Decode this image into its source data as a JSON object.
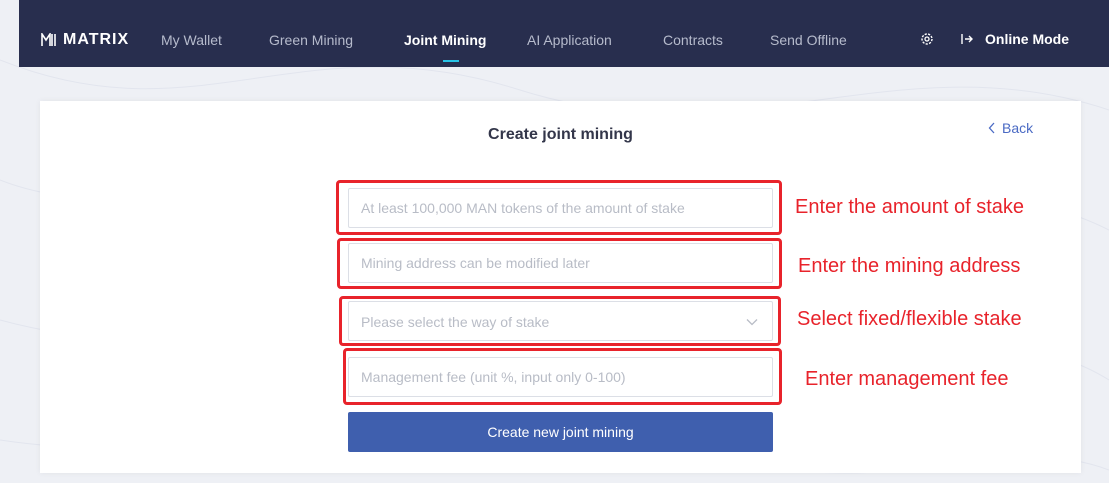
{
  "app": {
    "logo_text": "MATRIX"
  },
  "nav": {
    "items": [
      {
        "label": "My Wallet"
      },
      {
        "label": "Green Mining"
      },
      {
        "label": "Joint Mining",
        "active": true
      },
      {
        "label": "AI Application"
      },
      {
        "label": "Contracts"
      },
      {
        "label": "Send Offline"
      }
    ],
    "settings_icon": "gear-icon",
    "online_mode_icon": "login-icon",
    "online_mode_label": "Online Mode"
  },
  "page": {
    "title": "Create joint mining",
    "back_label": "Back",
    "back_icon": "chevron-left-icon"
  },
  "form": {
    "stake_amount": {
      "value": "",
      "placeholder": "At least 100,000 MAN tokens of the amount of stake"
    },
    "mining_address": {
      "value": "",
      "placeholder": "Mining address can be modified later"
    },
    "stake_way": {
      "placeholder": "Please select the way of stake",
      "icon": "chevron-down-icon"
    },
    "management_fee": {
      "value": "",
      "placeholder": "Management fee (unit %, input only 0-100)"
    },
    "submit_label": "Create new joint mining"
  },
  "annotations": {
    "stake_amount": "Enter the amount of stake",
    "mining_address": "Enter the mining address",
    "stake_way": "Select fixed/flexible stake",
    "management_fee": "Enter management fee"
  },
  "colors": {
    "topbar": "#282e4e",
    "accent_underline": "#28c3e6",
    "primary_button": "#3f5fae",
    "link": "#4a6ac4",
    "annotation_red": "#e8232b",
    "background": "#eef0f5"
  }
}
